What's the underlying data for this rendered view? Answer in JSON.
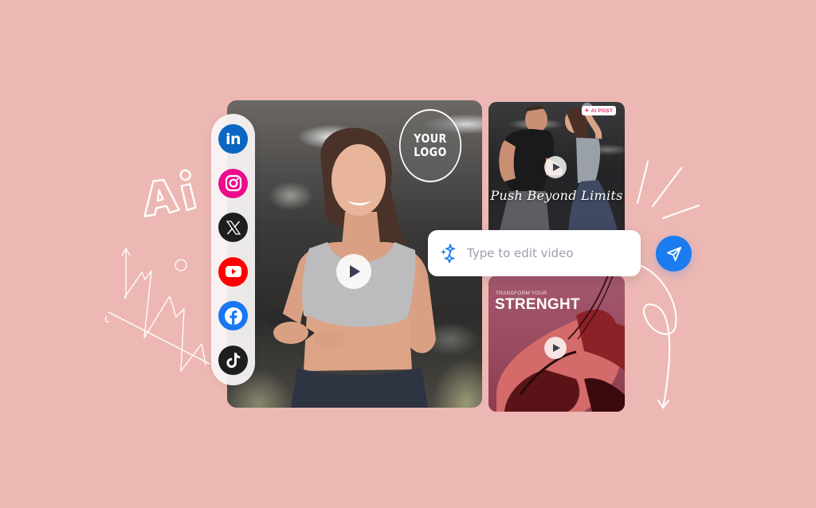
{
  "background_color": "#edb8b3",
  "decor": {
    "ai_doodle_text": "Ai"
  },
  "social": {
    "items": [
      {
        "name": "linkedin",
        "icon": "linkedin-icon",
        "glyph": "in",
        "color": "#0a66c2"
      },
      {
        "name": "instagram",
        "icon": "instagram-icon",
        "glyph": "",
        "color": "#ec0c8c"
      },
      {
        "name": "x",
        "icon": "x-icon",
        "glyph": "𝕏",
        "color": "#1e1e1e"
      },
      {
        "name": "youtube",
        "icon": "youtube-icon",
        "glyph": "",
        "color": "#ff0000"
      },
      {
        "name": "facebook",
        "icon": "facebook-icon",
        "glyph": "f",
        "color": "#1877f2"
      },
      {
        "name": "tiktok",
        "icon": "tiktok-icon",
        "glyph": "♪",
        "color": "#1e1e1e"
      }
    ]
  },
  "main_video": {
    "logo_line1": "YOUR",
    "logo_line2": "LOGO"
  },
  "card_top": {
    "badge": "AI POST",
    "caption": "Push Beyond Limits"
  },
  "card_bottom": {
    "kicker": "TRANSFORM YOUR",
    "headline": "STRENGHT"
  },
  "prompt": {
    "placeholder": "Type to edit video",
    "value": "",
    "accent_color": "#1a7cf0"
  }
}
